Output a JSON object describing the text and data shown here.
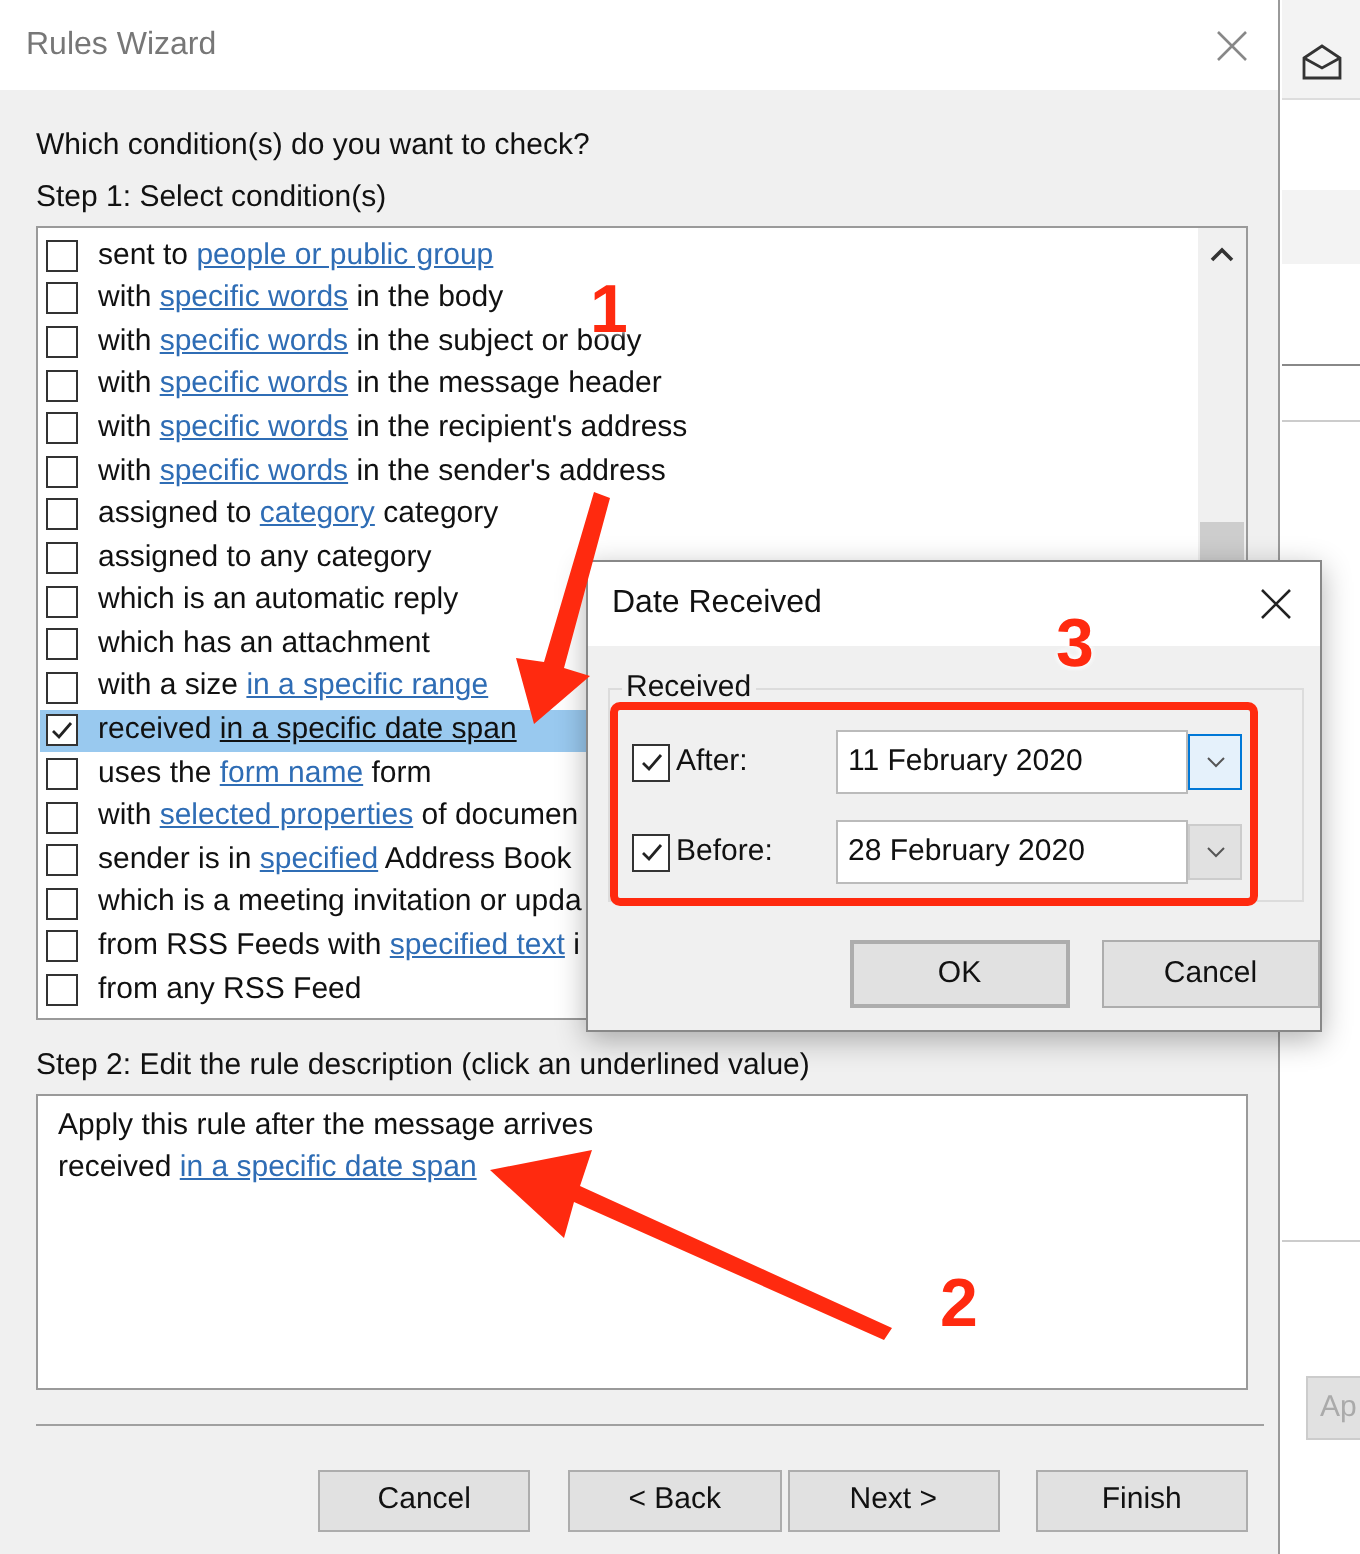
{
  "window": {
    "title": "Rules Wizard"
  },
  "question": "Which condition(s) do you want to check?",
  "step1_label": "Step 1: Select condition(s)",
  "conditions": [
    {
      "checked": false,
      "selected": false,
      "parts": [
        {
          "kind": "text",
          "text": "sent to "
        },
        {
          "kind": "link",
          "text": "people or public group"
        }
      ]
    },
    {
      "checked": false,
      "selected": false,
      "parts": [
        {
          "kind": "text",
          "text": "with "
        },
        {
          "kind": "link",
          "text": "specific words"
        },
        {
          "kind": "text",
          "text": " in the body"
        }
      ]
    },
    {
      "checked": false,
      "selected": false,
      "parts": [
        {
          "kind": "text",
          "text": "with "
        },
        {
          "kind": "link",
          "text": "specific words"
        },
        {
          "kind": "text",
          "text": " in the subject or body"
        }
      ]
    },
    {
      "checked": false,
      "selected": false,
      "parts": [
        {
          "kind": "text",
          "text": "with "
        },
        {
          "kind": "link",
          "text": "specific words"
        },
        {
          "kind": "text",
          "text": " in the message header"
        }
      ]
    },
    {
      "checked": false,
      "selected": false,
      "parts": [
        {
          "kind": "text",
          "text": "with "
        },
        {
          "kind": "link",
          "text": "specific words"
        },
        {
          "kind": "text",
          "text": " in the recipient's address"
        }
      ]
    },
    {
      "checked": false,
      "selected": false,
      "parts": [
        {
          "kind": "text",
          "text": "with "
        },
        {
          "kind": "link",
          "text": "specific words"
        },
        {
          "kind": "text",
          "text": " in the sender's address"
        }
      ]
    },
    {
      "checked": false,
      "selected": false,
      "parts": [
        {
          "kind": "text",
          "text": "assigned to "
        },
        {
          "kind": "link",
          "text": "category"
        },
        {
          "kind": "text",
          "text": " category"
        }
      ]
    },
    {
      "checked": false,
      "selected": false,
      "parts": [
        {
          "kind": "text",
          "text": "assigned to any category"
        }
      ]
    },
    {
      "checked": false,
      "selected": false,
      "parts": [
        {
          "kind": "text",
          "text": "which is an automatic reply"
        }
      ]
    },
    {
      "checked": false,
      "selected": false,
      "parts": [
        {
          "kind": "text",
          "text": "which has an attachment"
        }
      ]
    },
    {
      "checked": false,
      "selected": false,
      "parts": [
        {
          "kind": "text",
          "text": "with a size "
        },
        {
          "kind": "link",
          "text": "in a specific range"
        }
      ]
    },
    {
      "checked": true,
      "selected": true,
      "parts": [
        {
          "kind": "text",
          "text": "received "
        },
        {
          "kind": "link",
          "text": "in a specific date span"
        }
      ]
    },
    {
      "checked": false,
      "selected": false,
      "parts": [
        {
          "kind": "text",
          "text": "uses the "
        },
        {
          "kind": "link",
          "text": "form name"
        },
        {
          "kind": "text",
          "text": " form"
        }
      ]
    },
    {
      "checked": false,
      "selected": false,
      "parts": [
        {
          "kind": "text",
          "text": "with "
        },
        {
          "kind": "link",
          "text": "selected properties"
        },
        {
          "kind": "text",
          "text": " of documen"
        }
      ]
    },
    {
      "checked": false,
      "selected": false,
      "parts": [
        {
          "kind": "text",
          "text": "sender is in "
        },
        {
          "kind": "link",
          "text": "specified"
        },
        {
          "kind": "text",
          "text": " Address Book"
        }
      ]
    },
    {
      "checked": false,
      "selected": false,
      "parts": [
        {
          "kind": "text",
          "text": "which is a meeting invitation or upda"
        }
      ]
    },
    {
      "checked": false,
      "selected": false,
      "parts": [
        {
          "kind": "text",
          "text": "from RSS Feeds with "
        },
        {
          "kind": "link",
          "text": "specified text"
        },
        {
          "kind": "text",
          "text": " i"
        }
      ]
    },
    {
      "checked": false,
      "selected": false,
      "parts": [
        {
          "kind": "text",
          "text": "from any RSS Feed"
        }
      ]
    }
  ],
  "step2_label": "Step 2: Edit the rule description (click an underlined value)",
  "description": [
    [
      {
        "kind": "text",
        "text": "Apply this rule after the message arrives"
      }
    ],
    [
      {
        "kind": "text",
        "text": "received "
      },
      {
        "kind": "link",
        "text": "in a specific date span"
      }
    ]
  ],
  "buttons": [
    "Cancel",
    "< Back",
    "Next >",
    "Finish"
  ],
  "background_window": {
    "button": "Ap"
  },
  "date_dialog": {
    "title": "Date Received",
    "group": "Received",
    "rows": [
      {
        "label": "After:",
        "checked": true,
        "value": "11 February 2020",
        "focused": true
      },
      {
        "label": "Before:",
        "checked": true,
        "value": "28 February 2020",
        "focused": false
      }
    ],
    "buttons": [
      {
        "label": "OK",
        "default": true
      },
      {
        "label": "Cancel",
        "default": false
      }
    ]
  },
  "annotations": [
    "1",
    "2",
    "3"
  ]
}
